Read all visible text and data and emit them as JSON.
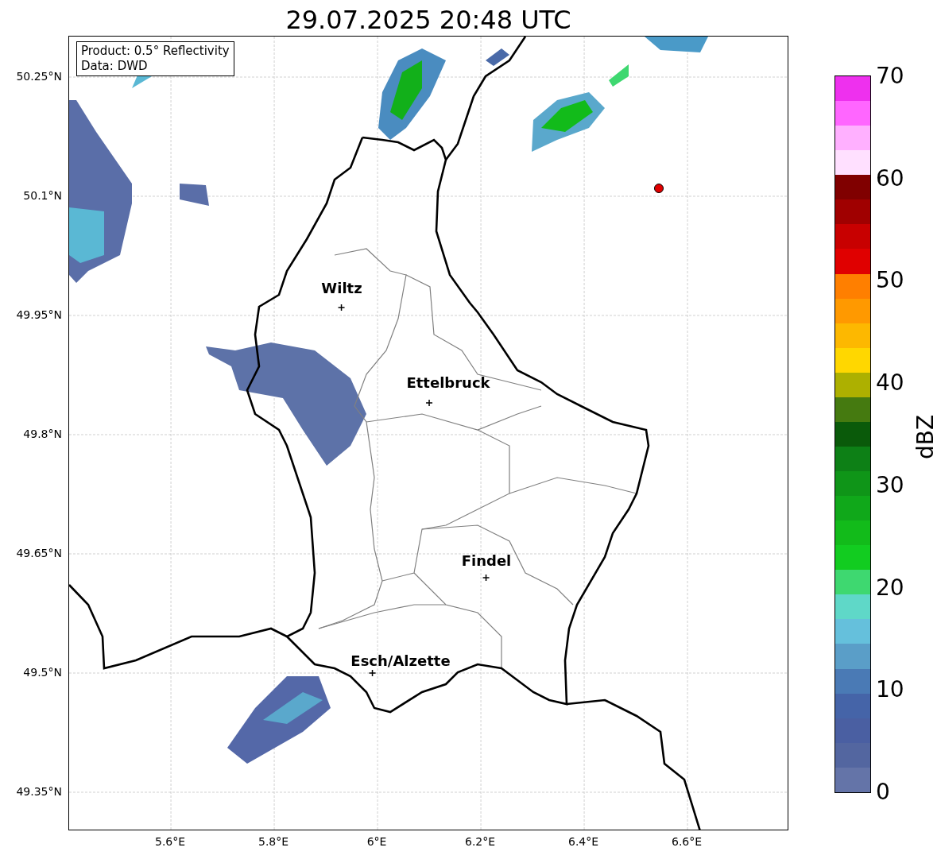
{
  "title": "29.07.2025 20:48 UTC",
  "info_box": {
    "product": "Product: 0.5° Reflectivity",
    "source": "Data: DWD"
  },
  "y_ticks": [
    "50.25°N",
    "50.1°N",
    "49.95°N",
    "49.8°N",
    "49.65°N",
    "49.5°N",
    "49.35°N"
  ],
  "x_ticks": [
    "5.6°E",
    "5.8°E",
    "6°E",
    "6.2°E",
    "6.4°E",
    "6.6°E"
  ],
  "cities": [
    {
      "name": "Wiltz"
    },
    {
      "name": "Ettelbruck"
    },
    {
      "name": "Findel"
    },
    {
      "name": "Esch/Alzette"
    }
  ],
  "colorbar": {
    "label": "dBZ",
    "ticks": [
      "70",
      "60",
      "50",
      "40",
      "30",
      "20",
      "10",
      "0"
    ],
    "bands": [
      {
        "color": "#ee30ee"
      },
      {
        "color": "#ff66ff"
      },
      {
        "color": "#ffb0ff"
      },
      {
        "color": "#ffe0ff"
      },
      {
        "color": "#800000"
      },
      {
        "color": "#a00000"
      },
      {
        "color": "#c80000"
      },
      {
        "color": "#e00000"
      },
      {
        "color": "#ff7f00"
      },
      {
        "color": "#ff9900"
      },
      {
        "color": "#fdb800"
      },
      {
        "color": "#ffd700"
      },
      {
        "color": "#adb000"
      },
      {
        "color": "#457a10"
      },
      {
        "color": "#0a5a0a"
      },
      {
        "color": "#0d8016"
      },
      {
        "color": "#0f9518"
      },
      {
        "color": "#10a81a"
      },
      {
        "color": "#12bb1a"
      },
      {
        "color": "#12cc20"
      },
      {
        "color": "#3ed870"
      },
      {
        "color": "#5fd8c8"
      },
      {
        "color": "#65c0dc"
      },
      {
        "color": "#5a9ec8"
      },
      {
        "color": "#4a7ab5"
      },
      {
        "color": "#4564a8"
      },
      {
        "color": "#4a5fa2"
      },
      {
        "color": "#5366a0"
      },
      {
        "color": "#6474a8"
      }
    ]
  }
}
